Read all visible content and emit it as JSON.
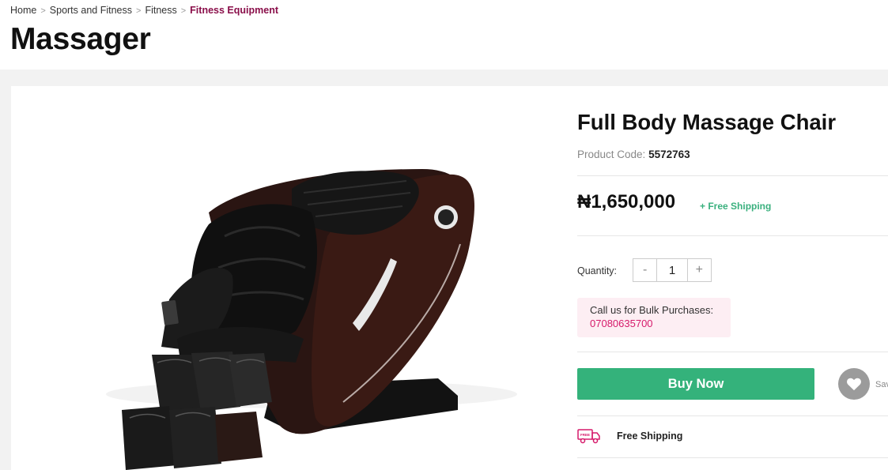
{
  "breadcrumb": {
    "items": [
      "Home",
      "Sports and Fitness",
      "Fitness"
    ],
    "current": "Fitness Equipment",
    "separator": ">"
  },
  "page": {
    "title": "Massager"
  },
  "product": {
    "name": "Full Body Massage Chair",
    "code_label": "Product Code:",
    "code": "5572763",
    "price": "₦1,650,000",
    "shipping_tag": "+ Free Shipping",
    "quantity_label": "Quantity:",
    "quantity": "1",
    "decrement": "-",
    "increment": "+",
    "bulk_label": "Call us for Bulk Purchases:",
    "bulk_phone": "07080635700",
    "buy_label": "Buy Now",
    "save_label": "Save",
    "free_shipping_label": "Free Shipping",
    "truck_icon_text": "FREE"
  },
  "colors": {
    "accent": "#34b27b",
    "brand": "#8a0f4a",
    "phone": "#d61a6b",
    "bulk_bg": "#fdeef3"
  },
  "icons": {
    "save": "heart-icon",
    "shipping": "truck-icon"
  }
}
